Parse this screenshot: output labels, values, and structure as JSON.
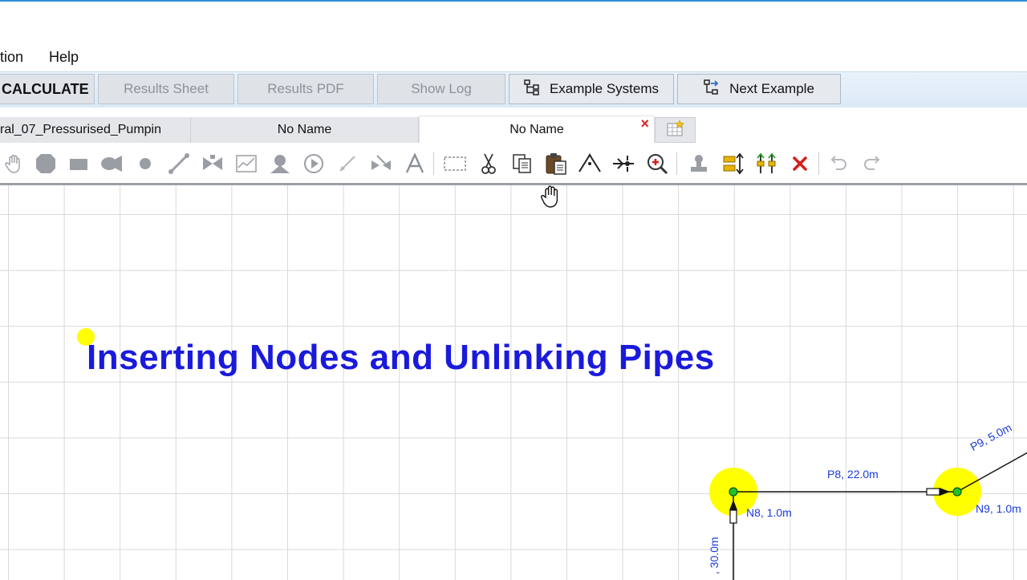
{
  "menu": {
    "items": [
      "tion",
      "Help"
    ]
  },
  "buttons": {
    "calculate": "CALCULATE",
    "results_sheet": "Results Sheet",
    "results_pdf": "Results PDF",
    "show_log": "Show Log",
    "example_systems": "Example Systems",
    "next_example": "Next Example"
  },
  "tabs": [
    {
      "label": "ral_07_Pressurised_Pumpin"
    },
    {
      "label": "No Name"
    },
    {
      "label": "No Name",
      "active": true,
      "close": "×"
    }
  ],
  "toolbar": {
    "icons": [
      "pan-hand-icon",
      "tank-icon",
      "reservoir-icon",
      "pump-icon",
      "node-icon",
      "pipe-icon",
      "valve-icon",
      "chart-icon",
      "pressure-pump-icon",
      "play-icon",
      "line-icon",
      "check-valve-icon",
      "text-tool-icon",
      "select-box-icon",
      "cut-icon",
      "copy-icon",
      "paste-icon",
      "unlink-icon",
      "insert-node-icon",
      "zoom-in-icon",
      "stamp-icon",
      "align-icon",
      "distribute-icon",
      "delete-icon",
      "undo-icon",
      "redo-icon"
    ]
  },
  "canvas": {
    "title": "Inserting Nodes and Unlinking Pipes",
    "nodes": [
      {
        "id": "N8",
        "label": "N8, 1.0m"
      },
      {
        "id": "N9",
        "label": "N9, 1.0m"
      }
    ],
    "pipes": [
      {
        "id": "P8",
        "label": "P8, 22.0m"
      },
      {
        "id": "P9",
        "label": "P9, 5.0m"
      },
      {
        "id": "P7",
        "label": ", 30.0m"
      }
    ]
  },
  "colors": {
    "title": "#1a1adc",
    "node_highlight": "#ffff00",
    "node_fill": "#22c22a",
    "close_x": "#e0201b",
    "label": "#1a3ad8"
  }
}
